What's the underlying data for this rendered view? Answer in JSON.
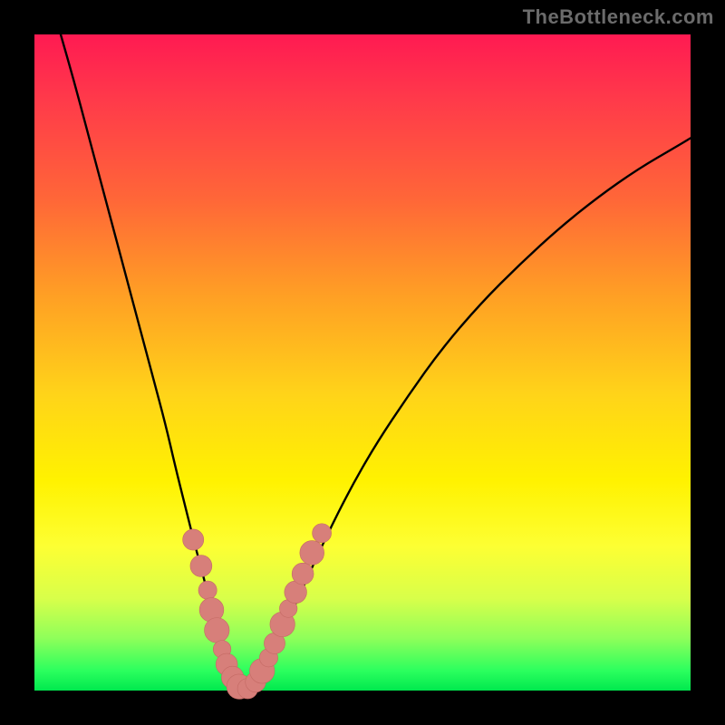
{
  "watermark": "TheBottleneck.com",
  "colors": {
    "curve": "#000000",
    "marker_fill": "#d77f7a",
    "marker_stroke": "#c46a64",
    "bg_black": "#000000"
  },
  "chart_data": {
    "type": "line",
    "title": "",
    "xlabel": "",
    "ylabel": "",
    "xlim": [
      0,
      100
    ],
    "ylim": [
      0,
      100
    ],
    "grid": false,
    "legend": false,
    "series": [
      {
        "name": "left-curve",
        "x": [
          4,
          6,
          8,
          10,
          12,
          14,
          16,
          18,
          20,
          21.5,
          23,
          24.5,
          26,
          27,
          28,
          28.8,
          29.5,
          30.2,
          30.8,
          31.4,
          32
        ],
        "y": [
          100,
          93,
          85.5,
          78,
          70.5,
          63,
          55.5,
          48,
          40.5,
          34,
          28,
          22,
          16.5,
          12,
          8,
          5.2,
          3.2,
          1.8,
          0.9,
          0.3,
          0
        ]
      },
      {
        "name": "right-curve",
        "x": [
          32,
          33,
          34,
          35.5,
          37,
          39,
          41.5,
          44.5,
          48,
          52,
          57,
          62,
          68,
          74,
          80,
          86,
          92,
          98,
          100
        ],
        "y": [
          0,
          0.6,
          1.8,
          4,
          7,
          11.5,
          17,
          23.5,
          30.5,
          37.5,
          45,
          52,
          59,
          65,
          70.5,
          75.3,
          79.5,
          83,
          84.2
        ]
      }
    ],
    "markers": [
      {
        "x": 24.2,
        "y": 23.0,
        "r": 1.6
      },
      {
        "x": 25.4,
        "y": 19.0,
        "r": 1.65
      },
      {
        "x": 26.4,
        "y": 15.3,
        "r": 1.4
      },
      {
        "x": 27.0,
        "y": 12.3,
        "r": 1.85
      },
      {
        "x": 27.8,
        "y": 9.2,
        "r": 1.9
      },
      {
        "x": 28.6,
        "y": 6.3,
        "r": 1.35
      },
      {
        "x": 29.3,
        "y": 4.0,
        "r": 1.65
      },
      {
        "x": 30.2,
        "y": 2.0,
        "r": 1.7
      },
      {
        "x": 31.2,
        "y": 0.6,
        "r": 1.9
      },
      {
        "x": 32.5,
        "y": 0.3,
        "r": 1.55
      },
      {
        "x": 33.7,
        "y": 1.3,
        "r": 1.55
      },
      {
        "x": 34.7,
        "y": 3.0,
        "r": 1.9
      },
      {
        "x": 35.7,
        "y": 5.0,
        "r": 1.4
      },
      {
        "x": 36.6,
        "y": 7.2,
        "r": 1.6
      },
      {
        "x": 37.8,
        "y": 10.1,
        "r": 1.9
      },
      {
        "x": 38.7,
        "y": 12.5,
        "r": 1.35
      },
      {
        "x": 39.8,
        "y": 15.0,
        "r": 1.7
      },
      {
        "x": 40.9,
        "y": 17.8,
        "r": 1.65
      },
      {
        "x": 42.3,
        "y": 21.0,
        "r": 1.85
      },
      {
        "x": 43.8,
        "y": 24.0,
        "r": 1.45
      }
    ]
  }
}
